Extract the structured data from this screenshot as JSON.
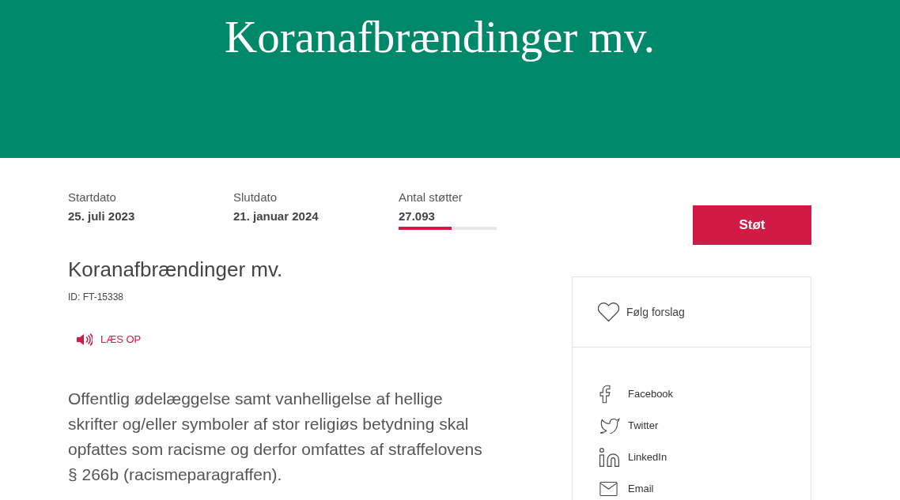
{
  "header": {
    "title": "Koranafbrændinger mv."
  },
  "stats": [
    {
      "label": "Startdato",
      "value": "25. juli 2023"
    },
    {
      "label": "Slutdato",
      "value": "21. januar 2024"
    },
    {
      "label": "Antal støtter",
      "value": "27.093",
      "level": 0.54
    }
  ],
  "support_button": {
    "label": "Støt"
  },
  "proposal": {
    "title": "Koranafbrændinger mv.",
    "id": "ID: FT-15338",
    "read_aloud": "LÆS OP",
    "description": "Offentlig ødelæggelse samt vanhelligelse af hellige skrifter og/eller symboler af stor religiøs betydning skal opfattes som racisme og derfor omfattes af straffelovens § 266b (racismeparagraffen)."
  },
  "sidebar": {
    "follow": {
      "label": "Følg forslag"
    },
    "share": [
      {
        "kind": "facebook",
        "label": "Facebook"
      },
      {
        "kind": "twitter",
        "label": "Twitter"
      },
      {
        "kind": "linkedin",
        "label": "LinkedIn"
      },
      {
        "kind": "email",
        "label": "Email"
      }
    ]
  }
}
